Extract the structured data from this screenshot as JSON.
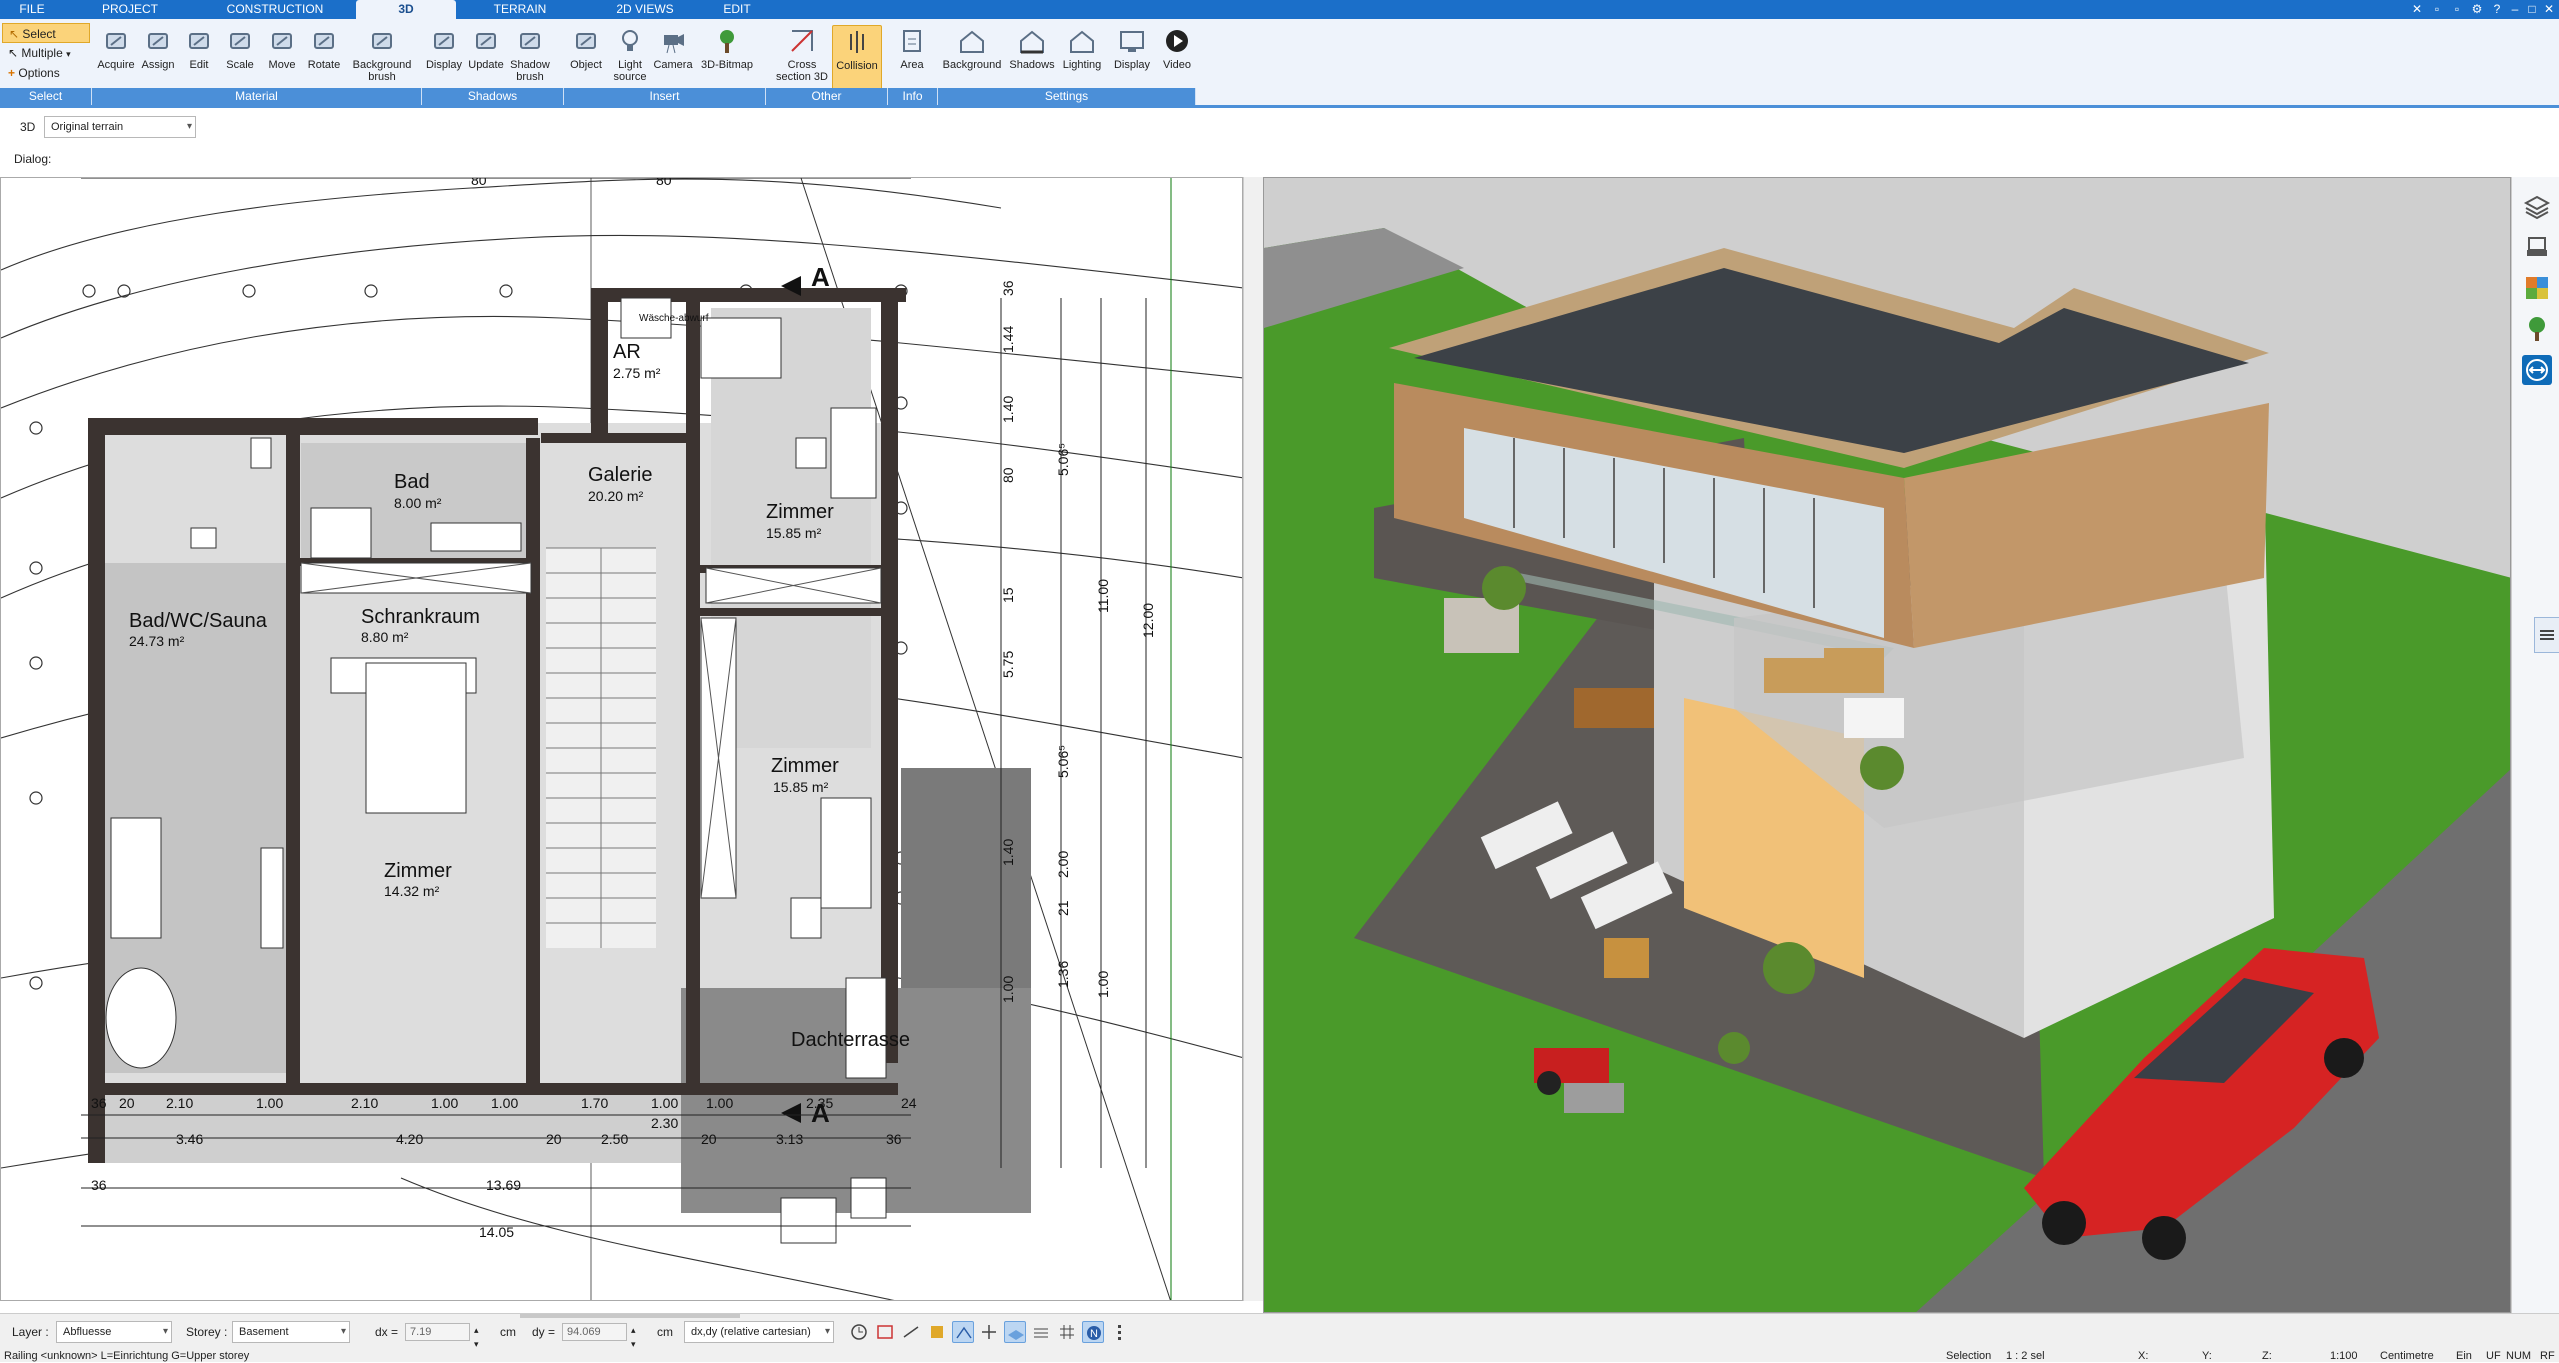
{
  "menu": {
    "tabs": [
      {
        "label": "FILE",
        "active": false
      },
      {
        "label": "PROJECT",
        "active": false
      },
      {
        "label": "CONSTRUCTION",
        "active": false
      },
      {
        "label": "3D",
        "active": true
      },
      {
        "label": "TERRAIN",
        "active": false
      },
      {
        "label": "2D VIEWS",
        "active": false
      },
      {
        "label": "EDIT",
        "active": false
      }
    ]
  },
  "ribbon": {
    "select": {
      "select_label": "Select",
      "multiple_label": "Multiple",
      "options_label": "Options"
    },
    "buttons": [
      {
        "label": "Acquire",
        "icon": "acquire-icon"
      },
      {
        "label": "Assign",
        "icon": "assign-icon"
      },
      {
        "label": "Edit",
        "icon": "edit-icon"
      },
      {
        "label": "Scale",
        "icon": "scale-icon"
      },
      {
        "label": "Move",
        "icon": "move-icon"
      },
      {
        "label": "Rotate",
        "icon": "rotate-icon"
      },
      {
        "label": "Background brush",
        "icon": "background-brush-icon"
      },
      {
        "label": "Display",
        "icon": "display-shadows-icon"
      },
      {
        "label": "Update",
        "icon": "update-icon"
      },
      {
        "label": "Shadow brush",
        "icon": "shadow-brush-icon"
      },
      {
        "label": "Object",
        "icon": "object-icon"
      },
      {
        "label": "Light source",
        "icon": "light-source-icon"
      },
      {
        "label": "Camera",
        "icon": "camera-icon"
      },
      {
        "label": "3D-Bitmap",
        "icon": "bitmap-3d-icon"
      },
      {
        "label": "Cross section 3D",
        "icon": "cross-section-icon"
      },
      {
        "label": "Collision",
        "icon": "collision-icon",
        "active": true
      },
      {
        "label": "Area",
        "icon": "area-icon"
      },
      {
        "label": "Background",
        "icon": "background-icon"
      },
      {
        "label": "Shadows",
        "icon": "shadows-icon"
      },
      {
        "label": "Lighting",
        "icon": "lighting-icon"
      },
      {
        "label": "Display",
        "icon": "display-settings-icon"
      },
      {
        "label": "Video",
        "icon": "video-icon"
      }
    ],
    "groups": [
      "Select",
      "Material",
      "Shadows",
      "Insert",
      "Other",
      "Info",
      "Settings"
    ]
  },
  "toolbar": {
    "mode_label": "3D",
    "terrain_value": "Original terrain"
  },
  "dialog": {
    "label": "Dialog:"
  },
  "plan": {
    "rooms": [
      {
        "name": "AR",
        "area": "2.75 m²"
      },
      {
        "name": "Bad",
        "area": "8.00 m²"
      },
      {
        "name": "Galerie",
        "area": "20.20 m²"
      },
      {
        "name": "Zimmer",
        "area": "15.85 m²"
      },
      {
        "name": "Bad/WC/Sauna",
        "area": "24.73 m²"
      },
      {
        "name": "Schrankraum",
        "area": "8.80 m²"
      },
      {
        "name": "Zimmer",
        "area": "15.85 m²"
      },
      {
        "name": "Zimmer",
        "area": "14.32 m²"
      },
      {
        "name": "Dachterrasse",
        "area": ""
      }
    ],
    "note": "Wäsche-abwurf",
    "section_marker": "A",
    "top_dims": [
      "80",
      "80"
    ],
    "dim_row1": [
      "36",
      "20",
      "2.10",
      "1.00",
      "2.10",
      "1.00",
      "1.00",
      "1.70",
      "1.00",
      "1.00",
      "2.35",
      "24"
    ],
    "dim_row2": [
      "3.46",
      "4.20",
      "20",
      "2.50",
      "2.30",
      "20",
      "3.13",
      "36"
    ],
    "dim_row3": [
      "36",
      "13.69"
    ],
    "dim_row4": [
      "14.05"
    ],
    "right_dims_a": [
      "36",
      "1.44",
      "1.40",
      "80",
      "15",
      "1.40",
      "1.00"
    ],
    "right_dims_b": [
      "5.06⁵",
      "5.06⁵",
      "2.00",
      "21",
      "1.36"
    ],
    "right_dims_c": [
      "5.75",
      "11.00",
      "12.00",
      "1.00"
    ]
  },
  "sidebar": {
    "icons": [
      "layers-icon",
      "furniture-icon",
      "materials-icon",
      "plants-icon",
      "teamviewer-icon"
    ]
  },
  "status": {
    "layer_label": "Layer :",
    "layer_value": "Abfluesse",
    "storey_label": "Storey :",
    "storey_value": "Basement",
    "dx_label": "dx =",
    "dx_value": "7.19",
    "dx_unit": "cm",
    "dy_label": "dy =",
    "dy_value": "94.069",
    "dy_unit": "cm",
    "coord_mode": "dx,dy (relative cartesian)"
  },
  "hint": {
    "text": "Railing <unknown> L=Einrichtung G=Upper storey",
    "selection": "Selection",
    "sel_count": "1 : 2 sel",
    "x_label": "X:",
    "y_label": "Y:",
    "z_label": "Z:",
    "scale": "1:100",
    "unit": "Centimetre",
    "ein": "Ein",
    "uf": "UF",
    "num": "NUM",
    "rf": "RF"
  },
  "colors": {
    "accent": "#1b6fc9",
    "ribbon_bg": "#eef3fb",
    "group_bar": "#4b8fd8",
    "active_button": "#fbd37a",
    "lawn": "#4a9a2a",
    "roof": "#3c4147",
    "wood": "#b98b5e",
    "car": "#d62323"
  }
}
